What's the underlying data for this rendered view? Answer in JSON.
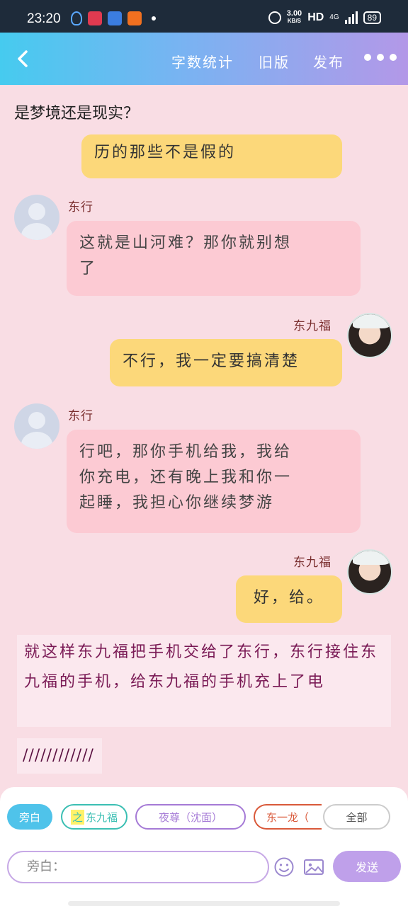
{
  "status_bar": {
    "time": "23:20",
    "speed_value": "3.00",
    "speed_unit": "KB/S",
    "network": "HD",
    "signal_type": "4G",
    "battery": "89"
  },
  "nav": {
    "word_count_label": "字数统计",
    "old_version_label": "旧版",
    "publish_label": "发布"
  },
  "chat": {
    "title": "是梦境还是现实？",
    "messages": [
      {
        "side": "right",
        "text": "历的那些不是假的"
      },
      {
        "side": "left",
        "name": "东行",
        "text_line1": "这就是山河难？那你就别想",
        "text_line2": "了"
      },
      {
        "side": "right",
        "name": "东九福",
        "text": "不行，我一定要搞清楚"
      },
      {
        "side": "left",
        "name": "东行",
        "text_line1": "行吧，那你手机给我，我给",
        "text_line2": "你充电，还有晚上我和你一",
        "text_line3": "起睡，我担心你继续梦游"
      },
      {
        "side": "right",
        "name": "东九福",
        "text": "好，给。"
      }
    ],
    "narration": "就这样东九福把手机交给了东行，东行接住东九福的手机，给东九福的手机充上了电",
    "slashes": "////////////"
  },
  "composer": {
    "active_role": "旁白",
    "chips": [
      {
        "highlight": "之",
        "label": "东九福",
        "color": "#3bbfb3"
      },
      {
        "label": "夜尊（沈面）",
        "color": "#a57ad6"
      },
      {
        "label": "东一龙（",
        "color": "#d9593a"
      },
      {
        "label": "全部",
        "color": "#cccccc"
      }
    ],
    "input_placeholder": "旁白：",
    "send_label": "发送"
  },
  "colors": {
    "nav_gradient_start": "#46cbef",
    "nav_gradient_end": "#b398e8",
    "background": "#f9dde4",
    "yellow_bubble": "#fcd87a",
    "pink_bubble": "#fccad3",
    "narration_text": "#7a1a55"
  }
}
